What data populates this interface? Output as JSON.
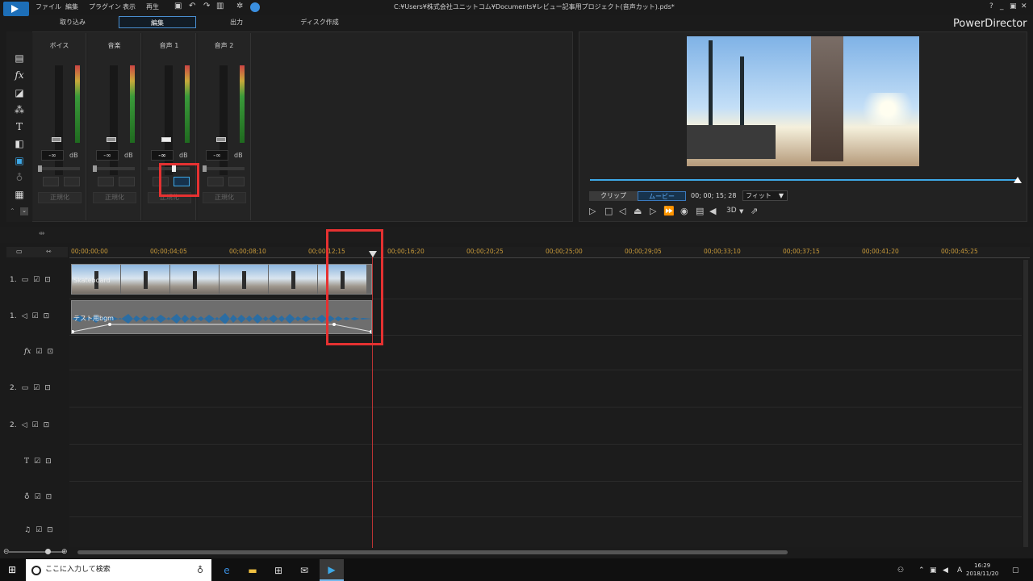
{
  "app": {
    "title": "C:¥Users¥株式会社ユニットコム¥Documents¥レビュー記事用プロジェクト(音声カット).pds*",
    "brand": "PowerDirector",
    "menu": [
      "ファイル",
      "編集",
      "プラグイン",
      "表示",
      "再生"
    ],
    "win_buttons": [
      "?",
      "_",
      "▣",
      "✕"
    ]
  },
  "modes": {
    "import": "取り込み",
    "edit": "編集",
    "output": "出力",
    "disc": "ディスク作成"
  },
  "mixer": {
    "channels": [
      {
        "name": "ボイス",
        "db": "-∞",
        "unit": "dB",
        "normalize": "正規化"
      },
      {
        "name": "音楽",
        "db": "-∞",
        "unit": "dB",
        "normalize": "正規化"
      },
      {
        "name": "音声 1",
        "db": "-∞",
        "unit": "dB",
        "normalize": "正規化"
      },
      {
        "name": "音声 2",
        "db": "-∞",
        "unit": "dB",
        "normalize": "正規化"
      }
    ]
  },
  "preview": {
    "clip_tab": "クリップ",
    "movie_tab": "ムービー",
    "timecode": "00; 00; 15; 28",
    "fit": "フィット",
    "mode3d": "3D"
  },
  "timeline": {
    "ruler": [
      "00;00;00;00",
      "00;00;04;05",
      "00;00;08;10",
      "00;00;12;15",
      "00;00;16;20",
      "00;00;20;25",
      "00;00;25;00",
      "00;00;29;05",
      "00;00;33;10",
      "00;00;37;15",
      "00;00;41;20",
      "00;00;45;25"
    ],
    "tracks": [
      {
        "label": "1.",
        "type": "video"
      },
      {
        "label": "1.",
        "type": "audio"
      },
      {
        "label": "fx",
        "type": "fx"
      },
      {
        "label": "2.",
        "type": "video"
      },
      {
        "label": "2.",
        "type": "audio"
      },
      {
        "label": "T",
        "type": "title"
      },
      {
        "label": "",
        "type": "voice"
      },
      {
        "label": "",
        "type": "music"
      }
    ],
    "video_clip": "Skateboard",
    "audio_clip": "テスト用bgm"
  },
  "taskbar": {
    "search_placeholder": "ここに入力して検索",
    "time": "16:29",
    "date": "2018/11/20",
    "ime": "A"
  }
}
